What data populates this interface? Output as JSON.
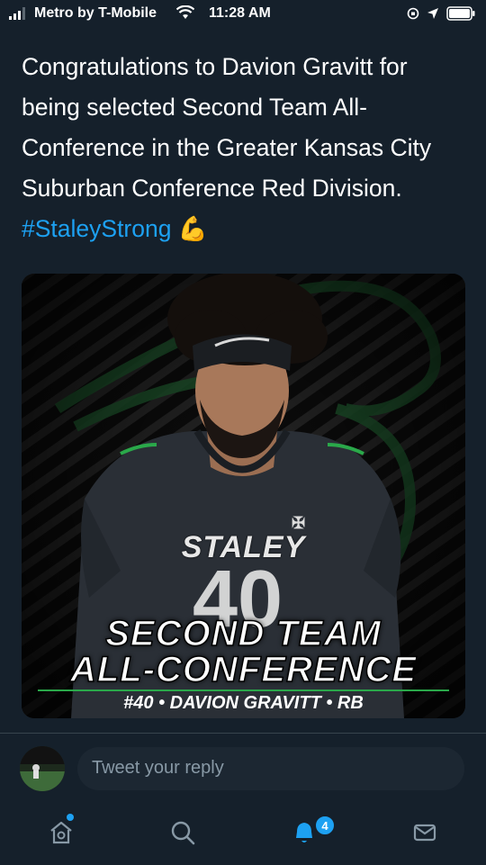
{
  "status_bar": {
    "carrier": "Metro by T-Mobile",
    "time": "11:28 AM",
    "icons": [
      "signal-icon",
      "wifi-icon",
      "rotation-lock-icon",
      "location-icon",
      "battery-icon"
    ]
  },
  "tweet": {
    "text": "Congratulations to Davion Gravitt for being selected Second Team All-Conference in the Greater Kansas City Suburban Conference Red Division.",
    "hashtag": "#StaleyStrong",
    "emoji": "💪"
  },
  "media": {
    "jersey_text": "STALEY",
    "headline_line1": "SECOND TEAM",
    "headline_line2": "ALL-CONFERENCE",
    "caption": "#40 • DAVION GRAVITT • RB",
    "colors": {
      "accent_green": "#2aa84a",
      "jersey": "#2a2f36"
    }
  },
  "reply": {
    "placeholder": "Tweet your reply"
  },
  "nav": {
    "items": [
      "home-icon",
      "search-icon",
      "notifications-icon",
      "messages-icon"
    ],
    "notification_count": "4"
  },
  "colors": {
    "background": "#15202b",
    "link": "#1da1f2",
    "muted": "#8899a6"
  }
}
